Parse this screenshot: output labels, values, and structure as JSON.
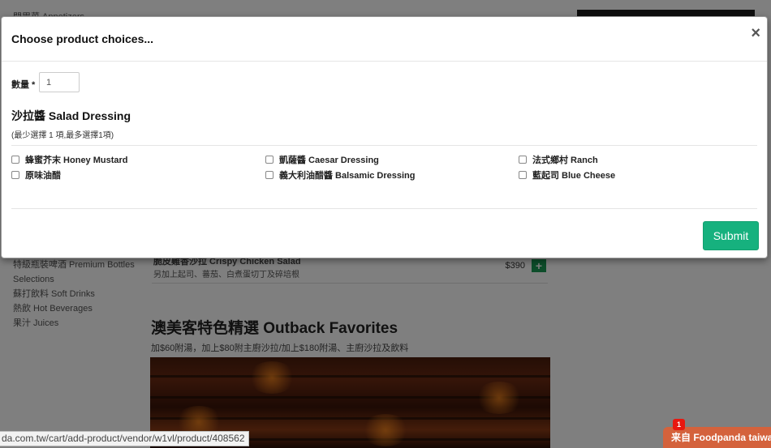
{
  "background": {
    "top_category": "開胃菜 Appetizers",
    "nav_items": [
      "特級瓶裝啤酒 Premium Bottles",
      "Selections",
      "蘇打飲料 Soft Drinks",
      "熱飲 Hot Beverages",
      "果汁 Juices"
    ],
    "item": {
      "name": "脆皮雞香沙拉 Crispy Chicken Salad",
      "description": "另加上起司、蕃茄、白煮蛋切丁及碎培根",
      "price": "$390",
      "add_label": "+"
    },
    "section": {
      "title": "澳美客特色精選 Outback Favorites",
      "description": "加$60附湯，加上$80附主廚沙拉/加上$180附湯、主廚沙拉及飲料"
    }
  },
  "modal": {
    "title": "Choose product choices...",
    "close_label": "×",
    "quantity": {
      "label": "數量 *",
      "value": "1"
    },
    "group": {
      "title": "沙拉醬 Salad Dressing",
      "hint": "(最少選擇 1 項,最多選擇1項)",
      "options": [
        "蜂蜜芥末 Honey Mustard",
        "原味油醋",
        "凱薩醬 Caesar Dressing",
        "義大利油醋醬 Balsamic Dressing",
        "法式鄉村 Ranch",
        "藍起司 Blue Cheese"
      ]
    },
    "submit_label": "Submit"
  },
  "status_bar": {
    "url": "da.com.tw/cart/add-product/vendor/w1vl/product/408562"
  },
  "chat": {
    "label": "来自 Foodpanda taiwan",
    "badge": "1"
  }
}
